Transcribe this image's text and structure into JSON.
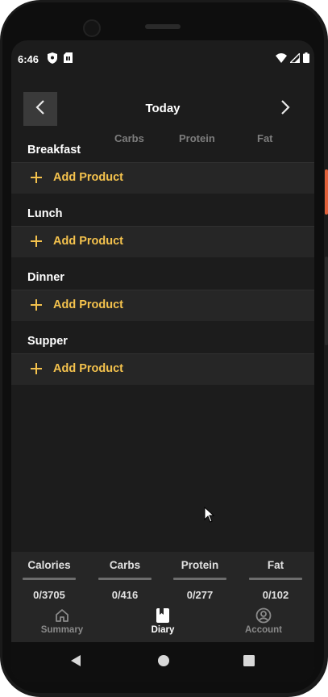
{
  "status_bar": {
    "time": "6:46",
    "left_icons": [
      "shield-icon",
      "sim-card-icon"
    ],
    "right_icons": [
      "wifi-icon",
      "signal-icon",
      "battery-icon"
    ]
  },
  "header": {
    "title": "Today",
    "back_icon": "chevron-left-icon",
    "next_icon": "chevron-right-icon"
  },
  "columns": [
    "Carbs",
    "Protein",
    "Fat"
  ],
  "meals": [
    {
      "title": "Breakfast",
      "action": "Add Product"
    },
    {
      "title": "Lunch",
      "action": "Add Product"
    },
    {
      "title": "Dinner",
      "action": "Add Product"
    },
    {
      "title": "Supper",
      "action": "Add Product"
    }
  ],
  "summary": [
    {
      "label": "Calories",
      "value": "0/3705"
    },
    {
      "label": "Carbs",
      "value": "0/416"
    },
    {
      "label": "Protein",
      "value": "0/277"
    },
    {
      "label": "Fat",
      "value": "0/102"
    }
  ],
  "bottom_nav": [
    {
      "label": "Summary",
      "icon": "home-icon",
      "active": false
    },
    {
      "label": "Diary",
      "icon": "book-icon",
      "active": true
    },
    {
      "label": "Account",
      "icon": "account-icon",
      "active": false
    }
  ],
  "system_nav": [
    "back-triangle-icon",
    "home-circle-icon",
    "recents-square-icon"
  ],
  "colors": {
    "accent": "#f4c24d",
    "background": "#1c1c1c",
    "surface": "#262626",
    "muted_text": "#7d7d7d"
  }
}
